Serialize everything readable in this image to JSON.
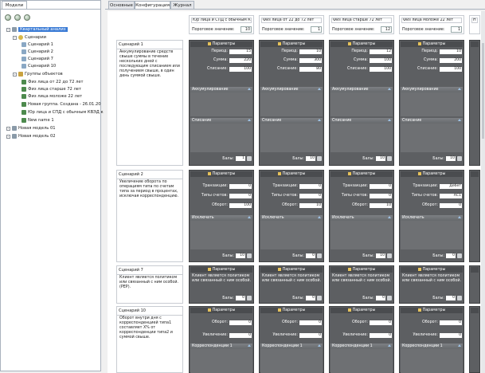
{
  "left": {
    "tab": "Модели",
    "tree": [
      {
        "label": "Квартальный анализ",
        "level": 0,
        "icon": "folder",
        "selected": true
      },
      {
        "label": "Сценарии",
        "level": 1,
        "icon": "scenario"
      },
      {
        "label": "Сценарий 1",
        "level": 2,
        "icon": "doc"
      },
      {
        "label": "Сценарий 2",
        "level": 2,
        "icon": "doc"
      },
      {
        "label": "Сценарий 7",
        "level": 2,
        "icon": "doc"
      },
      {
        "label": "Сценарий 10",
        "level": 2,
        "icon": "doc"
      },
      {
        "label": "Группы объектов",
        "level": 1,
        "icon": "group"
      },
      {
        "label": "Физ лица от 22 до 72 лет",
        "level": 2,
        "icon": "people"
      },
      {
        "label": "Физ лица старше 72 лет",
        "level": 2,
        "icon": "people"
      },
      {
        "label": "Физ лица моложе 22 лет",
        "level": 2,
        "icon": "people"
      },
      {
        "label": "Новая группа. Создана - 26.01.20",
        "level": 2,
        "icon": "people"
      },
      {
        "label": "Юр лица и СПД с обычным КВЭД к",
        "level": 2,
        "icon": "people"
      },
      {
        "label": "New name 1",
        "level": 2,
        "icon": "people"
      },
      {
        "label": "Новая модель 01",
        "level": 0,
        "icon": "folder"
      },
      {
        "label": "Новая модель 02",
        "level": 0,
        "icon": "folder"
      }
    ]
  },
  "tabs": [
    "Основные",
    "Конфигурация",
    "Журнал"
  ],
  "threshold_label": "Пороговое значение:",
  "columns": [
    {
      "name": "Юр лица и СПД с обычным КВЭД",
      "threshold": "10"
    },
    {
      "name": "Физ лица от 22 до 72 лет",
      "threshold": "1"
    },
    {
      "name": "Физ лица старше 72 лет",
      "threshold": "12"
    },
    {
      "name": "Физ лица моложе 22 лет",
      "threshold": "1"
    },
    {
      "name": "Н",
      "threshold": ""
    }
  ],
  "labels": {
    "params": "Параметры",
    "period": "Период:",
    "sum": "Сумма:",
    "writeoff": "Списание:",
    "accum": "Аккумулирование",
    "writeoff_sec": "Списание",
    "balls": "Балы:",
    "trans": "Транзакции:",
    "acct_types": "Типы счетов:",
    "turnover": "Оборот:",
    "exclude": "Исключать",
    "increase": "Увеличение:",
    "correspondence": "Корреспонденции 1"
  },
  "scenarios": [
    {
      "name": "Сценарий 1",
      "desc": "Аккумулирование средств свыше суммы в течение нескольких дней с последующим списанием или получением свыше, в один день суммой свыше.",
      "cells": [
        {
          "period": "15",
          "sum": "220",
          "writeoff": "100",
          "balls": "1"
        },
        {
          "period": "10",
          "sum": "300",
          "writeoff": "80",
          "balls": "10"
        },
        {
          "period": "12",
          "sum": "100",
          "writeoff": "100",
          "balls": "10"
        },
        {
          "period": "10",
          "sum": "200",
          "writeoff": "100",
          "balls": "10"
        }
      ]
    },
    {
      "name": "Сценарий 2",
      "desc": "Увеличение оборота по операциям типа по счетам типа за период в процентах, исключая корреспонденцию.",
      "cells": [
        {
          "trans": "0",
          "acct": "0",
          "turnover": "100",
          "balls": "10"
        },
        {
          "trans": "0",
          "acct": "0",
          "turnover": "10",
          "balls": "0"
        },
        {
          "trans": "0",
          "acct": "0",
          "turnover": "10",
          "balls": "10"
        },
        {
          "trans": "Дебет",
          "acct": "AC1",
          "turnover": "0",
          "balls": "0"
        }
      ]
    },
    {
      "name": "Сценарий 7",
      "desc": "Клиент является политиком или связанный с ним особой. (PEP).",
      "cells": [
        {
          "desc": "Клиент является политиком или связанный с ним особой.",
          "balls": "0"
        },
        {
          "desc": "Клиент является политиком или связанный с ним особой.",
          "balls": "0"
        },
        {
          "desc": "Клиент является политиком или связанный с ним особой.",
          "balls": "0"
        },
        {
          "desc": "Клиент является политиком или связанный с ним особой.",
          "balls": "0"
        }
      ]
    },
    {
      "name": "Сценарий 10",
      "desc": "Оборот внутри дня с корреспонденцией типа1 составляет X% от корреспонденции типа2 и суммой свыше.",
      "cells": [
        {
          "turnover": "0",
          "increase": "0"
        },
        {
          "turnover": "0",
          "increase": "0"
        },
        {
          "turnover": "0",
          "increase": "0"
        },
        {
          "turnover": "0",
          "increase": "0"
        }
      ]
    }
  ]
}
